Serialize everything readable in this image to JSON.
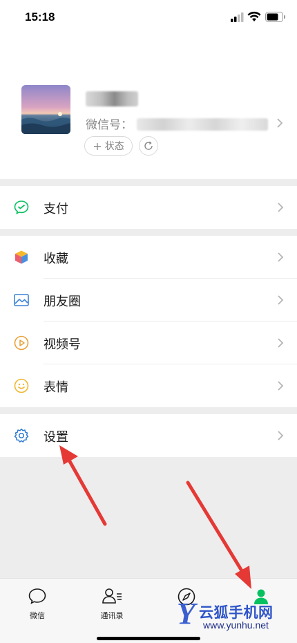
{
  "status_bar": {
    "time": "15:18"
  },
  "profile": {
    "wechat_id_label": "微信号：",
    "status_label": "状态"
  },
  "menu": {
    "pay": "支付",
    "favorites": "收藏",
    "moments": "朋友圈",
    "channels": "视频号",
    "stickers": "表情",
    "settings": "设置"
  },
  "tabbar": {
    "tabs": [
      {
        "label": "微信",
        "icon": "chat-bubble-icon"
      },
      {
        "label": "通讯录",
        "icon": "contacts-icon"
      },
      {
        "label": "",
        "icon": "compass-icon"
      },
      {
        "label": "",
        "icon": "me-icon"
      }
    ],
    "active_color": "#07c160"
  },
  "watermark": {
    "letter": "Y",
    "title": "云狐手机网",
    "url": "www.yunhu.net"
  },
  "colors": {
    "annotation_arrow": "#e53935",
    "pay_icon": "#07c160",
    "settings_icon": "#2f7bd3"
  }
}
